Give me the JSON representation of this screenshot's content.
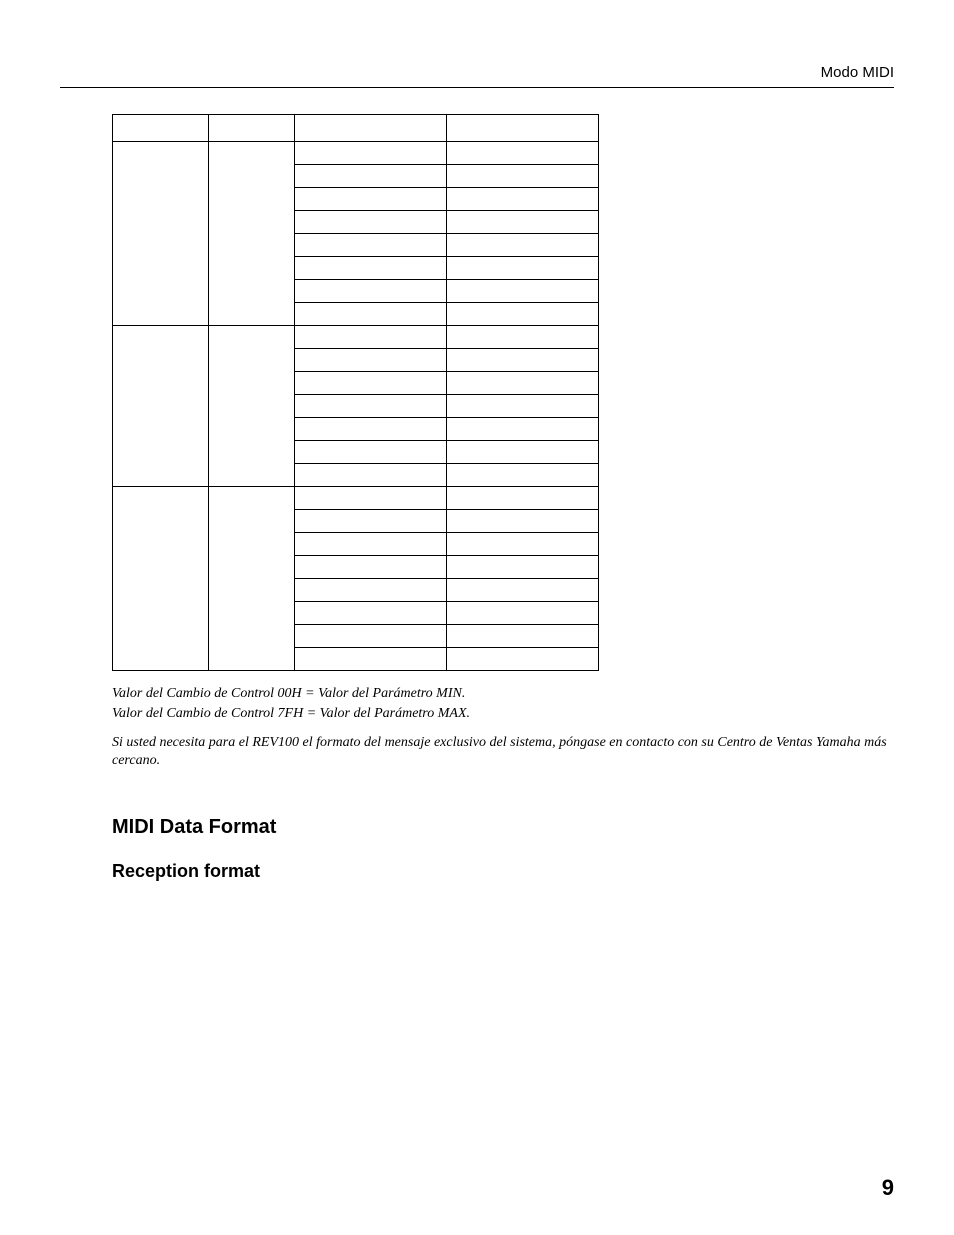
{
  "header": {
    "section_label": "Modo MIDI"
  },
  "table": {
    "header_cells": [
      "",
      "",
      "",
      ""
    ],
    "groups": [
      {
        "label": "",
        "rows": [
          [
            "",
            ""
          ],
          [
            "",
            ""
          ],
          [
            "",
            ""
          ],
          [
            "",
            ""
          ],
          [
            "",
            ""
          ],
          [
            "",
            ""
          ],
          [
            "",
            ""
          ],
          [
            "",
            ""
          ]
        ]
      },
      {
        "label": "",
        "rows": [
          [
            "",
            ""
          ],
          [
            "",
            ""
          ],
          [
            "",
            ""
          ],
          [
            "",
            ""
          ],
          [
            "",
            ""
          ],
          [
            "",
            ""
          ],
          [
            "",
            ""
          ]
        ]
      },
      {
        "label": "",
        "rows": [
          [
            "",
            ""
          ],
          [
            "",
            ""
          ],
          [
            "",
            ""
          ],
          [
            "",
            ""
          ],
          [
            "",
            ""
          ],
          [
            "",
            ""
          ],
          [
            "",
            ""
          ],
          [
            "",
            ""
          ]
        ]
      }
    ]
  },
  "notes": {
    "line1": "Valor del Cambio de Control 00H = Valor del Parámetro MIN.",
    "line2": "Valor del Cambio de Control 7FH = Valor del Parámetro MAX."
  },
  "sysex_note": "Si usted necesita para el REV100 el formato del mensaje exclusivo del sistema, póngase en contacto con su Centro de Ventas Yamaha más cercano.",
  "headings": {
    "midi_data_format": "MIDI Data Format",
    "reception_format": "Reception format"
  },
  "page_number": "9"
}
